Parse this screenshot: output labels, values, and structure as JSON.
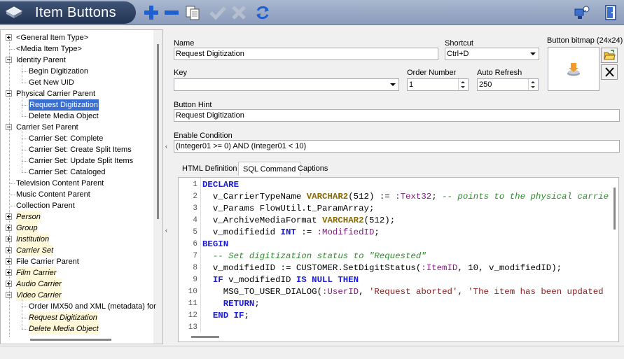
{
  "window": {
    "title": "Item Buttons"
  },
  "toolbar": {
    "icons": [
      "add-icon",
      "remove-icon",
      "copy-icon",
      "confirm-icon",
      "cancel-icon",
      "refresh-icon",
      "network-icon",
      "exit-icon"
    ]
  },
  "tree": {
    "items": [
      {
        "label": "<General Item Type>",
        "level": 0,
        "expander": "plus",
        "italic": false
      },
      {
        "label": "<Media Item Type>",
        "level": 0,
        "expander": "none",
        "italic": false
      },
      {
        "label": "Identity Parent",
        "level": 0,
        "expander": "minus",
        "italic": false
      },
      {
        "label": "Begin Digitization",
        "level": 1,
        "italic": false
      },
      {
        "label": "Get New UID",
        "level": 1,
        "italic": false
      },
      {
        "label": "Physical Carrier Parent",
        "level": 0,
        "expander": "minus",
        "italic": false
      },
      {
        "label": "Request Digitization",
        "level": 1,
        "italic": false,
        "selected": true
      },
      {
        "label": "Delete Media Object",
        "level": 1,
        "italic": false
      },
      {
        "label": "Carrier Set Parent",
        "level": 0,
        "expander": "minus",
        "italic": false
      },
      {
        "label": "Carrier Set: Complete",
        "level": 1,
        "italic": false
      },
      {
        "label": "Carrier Set: Create Split Items",
        "level": 1,
        "italic": false
      },
      {
        "label": "Carrier Set: Update Split Items",
        "level": 1,
        "italic": false
      },
      {
        "label": "Carrier Set: Cataloged",
        "level": 1,
        "italic": false
      },
      {
        "label": "Television Content Parent",
        "level": 0,
        "expander": "none",
        "italic": false
      },
      {
        "label": "Music Content Parent",
        "level": 0,
        "expander": "none",
        "italic": false
      },
      {
        "label": "Collection Parent",
        "level": 0,
        "expander": "none",
        "italic": false
      },
      {
        "label": "Person",
        "level": 0,
        "expander": "plus",
        "italic": true
      },
      {
        "label": "Group",
        "level": 0,
        "expander": "plus",
        "italic": true
      },
      {
        "label": "Institution",
        "level": 0,
        "expander": "plus",
        "italic": true
      },
      {
        "label": "Carrier Set",
        "level": 0,
        "expander": "plus",
        "italic": true
      },
      {
        "label": "File Carrier Parent",
        "level": 0,
        "expander": "plus",
        "italic": false
      },
      {
        "label": "Film Carrier",
        "level": 0,
        "expander": "plus",
        "italic": true
      },
      {
        "label": "Audio Carrier",
        "level": 0,
        "expander": "plus",
        "italic": true
      },
      {
        "label": "Video Carrier",
        "level": 0,
        "expander": "minus",
        "italic": true
      },
      {
        "label": "Order IMX50 and XML (metadata) for",
        "level": 1,
        "italic": false
      },
      {
        "label": "Request Digitization",
        "level": 1,
        "italic": true
      },
      {
        "label": "Delete Media Object",
        "level": 1,
        "italic": true
      }
    ]
  },
  "form": {
    "name_label": "Name",
    "name_value": "Request Digitization",
    "shortcut_label": "Shortcut",
    "shortcut_value": "Ctrl+D",
    "bitmap_label": "Button bitmap (24x24)",
    "key_label": "Key",
    "key_value": "",
    "order_label": "Order Number",
    "order_value": "1",
    "refresh_label": "Auto Refresh",
    "refresh_value": "250",
    "hint_label": "Button Hint",
    "hint_value": "Request Digitization",
    "condition_label": "Enable Condition",
    "condition_value": "(Integer01 >= 0) AND (Integer01 < 10)"
  },
  "tabs": [
    {
      "label": "HTML Definition",
      "active": false
    },
    {
      "label": "SQL Command",
      "active": true
    },
    {
      "label": "Captions",
      "active": false
    }
  ],
  "editor": {
    "lines": [
      "1",
      "2",
      "3",
      "4",
      "5",
      "6",
      "7",
      "8",
      "9",
      "10",
      "11",
      "12",
      "13"
    ]
  }
}
